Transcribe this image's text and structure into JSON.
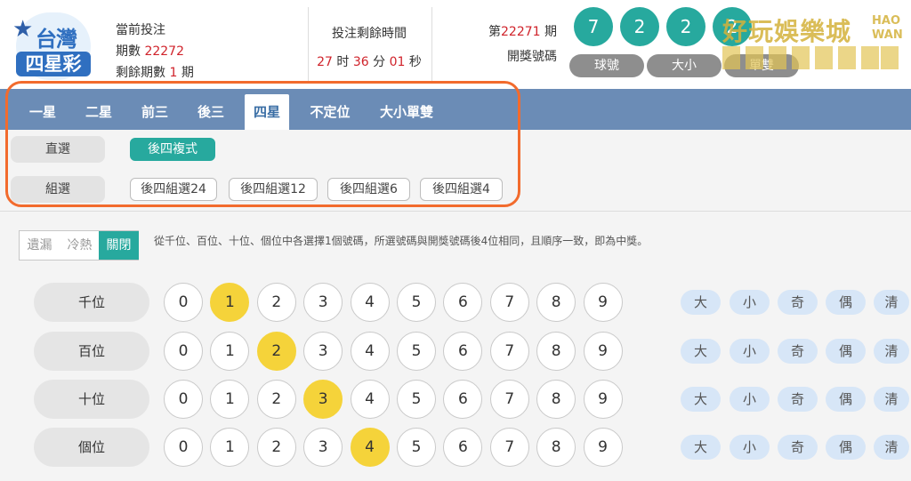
{
  "logo": {
    "line1": "台灣",
    "line2": "四星彩"
  },
  "current": {
    "label": "當前投注",
    "period_label": "期數",
    "period": "22272",
    "remaining_label": "剩餘期數",
    "remaining": "1",
    "remaining_unit": "期"
  },
  "timer": {
    "label": "投注剩餘時間",
    "hours": "27",
    "h_unit": "时",
    "minutes": "36",
    "m_unit": "分",
    "seconds": "01",
    "s_unit": "秒"
  },
  "draw": {
    "prefix": "第",
    "period": "22271",
    "suffix": "期",
    "label": "開獎號碼"
  },
  "balls": [
    "7",
    "2",
    "2",
    "2"
  ],
  "result_tabs": [
    "球號",
    "大小",
    "單雙"
  ],
  "watermark": {
    "text": "好玩娛樂城",
    "side1": "HAO",
    "side2": "WAN"
  },
  "tabs": [
    "一星",
    "二星",
    "前三",
    "後三",
    "四星",
    "不定位",
    "大小單雙"
  ],
  "active_tab": 4,
  "direct": {
    "label": "直選",
    "options": [
      "後四複式"
    ]
  },
  "group": {
    "label": "組選",
    "options": [
      "後四組選24",
      "後四組選12",
      "後四組選6",
      "後四組選4"
    ]
  },
  "toggle": [
    "遺漏",
    "冷熱",
    "關閉"
  ],
  "description": "從千位、百位、十位、個位中各選擇1個號碼，所選號碼與開獎號碼後4位相同，且順序一致，即為中獎。",
  "positions": [
    {
      "label": "千位",
      "selected": 1
    },
    {
      "label": "百位",
      "selected": 2
    },
    {
      "label": "十位",
      "selected": 3
    },
    {
      "label": "個位",
      "selected": 4
    }
  ],
  "digits": [
    "0",
    "1",
    "2",
    "3",
    "4",
    "5",
    "6",
    "7",
    "8",
    "9"
  ],
  "quick": [
    "大",
    "小",
    "奇",
    "偶",
    "清"
  ],
  "colors": {
    "teal": "#27a99e",
    "selected": "#f5d33a",
    "tabbar": "#6b8cb6",
    "highlight": "#f26b2d",
    "red": "#d0232b"
  }
}
